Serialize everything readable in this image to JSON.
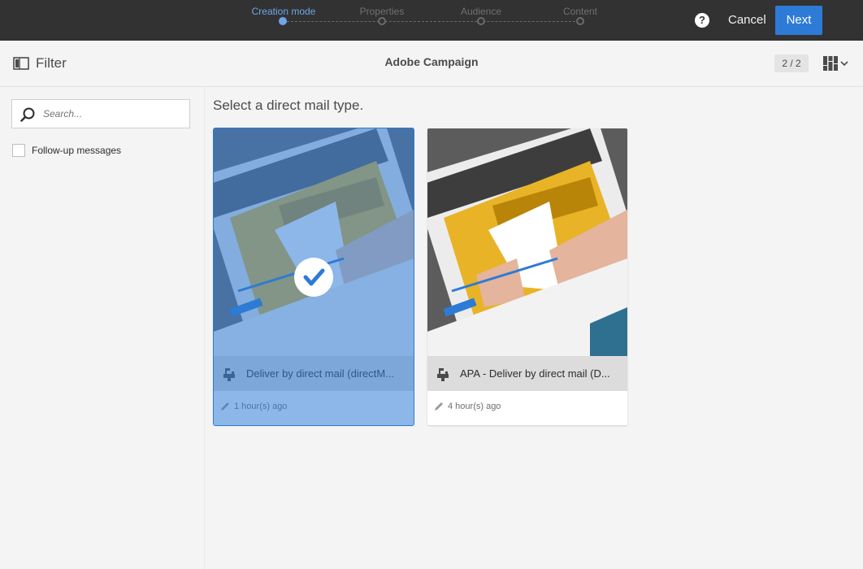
{
  "wizard": {
    "steps": [
      {
        "label": "Creation mode",
        "active": true
      },
      {
        "label": "Properties",
        "active": false
      },
      {
        "label": "Audience",
        "active": false
      },
      {
        "label": "Content",
        "active": false
      }
    ],
    "help_label": "?",
    "cancel_label": "Cancel",
    "next_label": "Next"
  },
  "header": {
    "filter_label": "Filter",
    "app_title": "Adobe Campaign",
    "page_count": "2 / 2"
  },
  "sidebar": {
    "search_placeholder": "Search...",
    "followup_label": "Follow-up messages",
    "followup_checked": false
  },
  "main": {
    "title": "Select a direct mail type.",
    "cards": [
      {
        "title": "Deliver by direct mail (directM...",
        "meta": "1 hour(s) ago",
        "selected": true,
        "icon": "direct-mail-icon"
      },
      {
        "title": "APA - Deliver by direct mail (D...",
        "meta": "4 hour(s) ago",
        "selected": false,
        "icon": "direct-mail-icon"
      }
    ]
  },
  "colors": {
    "accent": "#2d7bd6",
    "topbar": "#323232",
    "active_step": "#6ea6e8",
    "mailbox_yellow": "#e8b326"
  }
}
